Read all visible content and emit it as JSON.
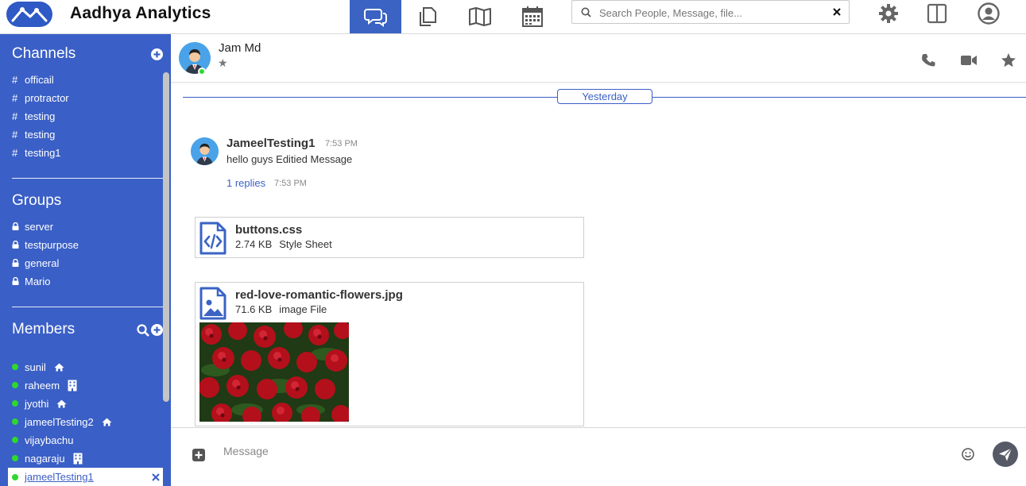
{
  "app": {
    "name": "Aadhya Analytics"
  },
  "nav": [
    {
      "icon": "chat-bubbles-icon",
      "active": true
    },
    {
      "icon": "files-icon",
      "active": false
    },
    {
      "icon": "map-icon",
      "active": false
    },
    {
      "icon": "calendar-icon",
      "active": false
    }
  ],
  "search": {
    "placeholder": "Search People, Message, file...",
    "value": ""
  },
  "topbar_icons": [
    "gear-icon",
    "split-panel-icon",
    "user-account-icon"
  ],
  "colors": {
    "brand": "#3a5fc6",
    "online": "#2ed82e",
    "active_nav": "#3a63c4"
  },
  "sidebar": {
    "channels": {
      "title": "Channels",
      "items": [
        {
          "prefix": "#",
          "label": "officail"
        },
        {
          "prefix": "#",
          "label": "protractor"
        },
        {
          "prefix": "#",
          "label": "testing"
        },
        {
          "prefix": "#",
          "label": "testing"
        },
        {
          "prefix": "#",
          "label": "testing1"
        }
      ]
    },
    "groups": {
      "title": "Groups",
      "items": [
        {
          "label": "server"
        },
        {
          "label": "testpurpose"
        },
        {
          "label": "general"
        },
        {
          "label": "Mario"
        }
      ]
    },
    "members": {
      "title": "Members",
      "items": [
        {
          "label": "sunil",
          "badge": "home-icon"
        },
        {
          "label": "raheem",
          "badge": "building-icon"
        },
        {
          "label": "jyothi",
          "badge": "home-icon"
        },
        {
          "label": "jameelTesting2",
          "badge": "home-icon"
        },
        {
          "label": "vijaybachu",
          "badge": ""
        },
        {
          "label": "nagaraju",
          "badge": "building-icon"
        },
        {
          "label": "jameelTesting1",
          "badge": "",
          "selected": true
        }
      ]
    }
  },
  "chat": {
    "contact_name": "Jam Md",
    "contact_star": "★",
    "day_divider": "Yesterday",
    "message": {
      "user": "JameelTesting1",
      "time": "7:53 PM",
      "text": "hello guys Editied Message",
      "replies": "1 replies",
      "replies_time": "7:53 PM"
    },
    "attachments": [
      {
        "name": "buttons.css",
        "size": "2.74 KB",
        "type": "Style Sheet",
        "icon": "code-file-icon"
      },
      {
        "name": "red-love-romantic-flowers.jpg",
        "size": "71.6 KB",
        "type": "image File",
        "icon": "image-file-icon"
      }
    ]
  },
  "composer": {
    "placeholder": "Message",
    "value": ""
  }
}
